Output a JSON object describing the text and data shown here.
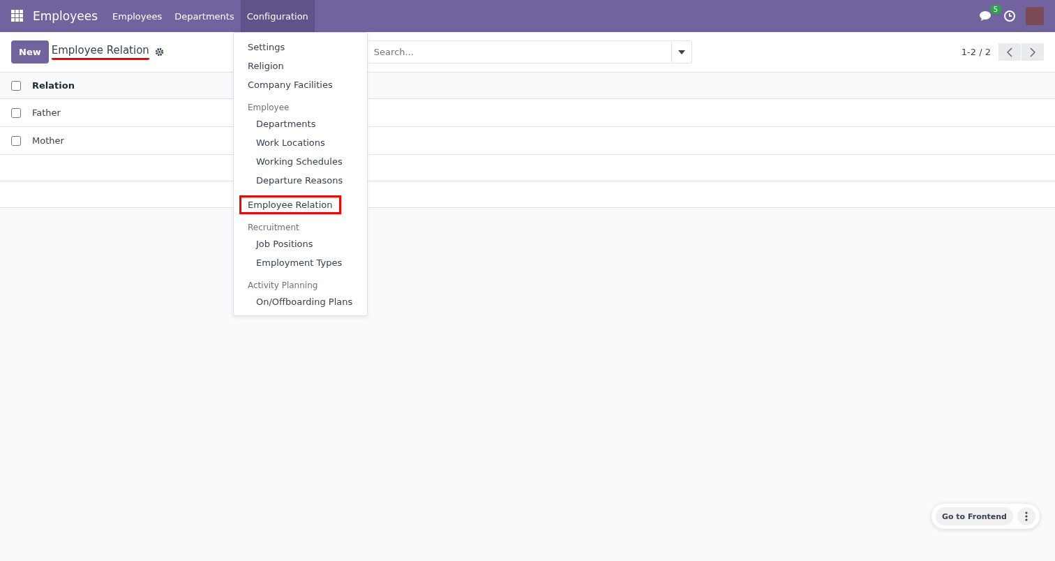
{
  "navbar": {
    "app_name": "Employees",
    "menus": [
      {
        "label": "Employees",
        "selected": false
      },
      {
        "label": "Departments",
        "selected": false
      },
      {
        "label": "Configuration",
        "selected": true
      }
    ],
    "messages_badge": "5"
  },
  "control_panel": {
    "new_button": "New",
    "title": "Employee Relation",
    "title_underlined": true,
    "search": {
      "placeholder": "Search..."
    },
    "pager": "1-2 / 2"
  },
  "table": {
    "columns": [
      "Relation"
    ],
    "all_checked": false,
    "rows": [
      {
        "cells": [
          "Father"
        ],
        "checked": false
      },
      {
        "cells": [
          "Mother"
        ],
        "checked": false
      }
    ]
  },
  "dropdown": [
    {
      "kind": "item",
      "label": "Settings",
      "highlighted": false
    },
    {
      "kind": "item",
      "label": "Religion",
      "highlighted": false
    },
    {
      "kind": "item",
      "label": "Company Facilities",
      "highlighted": false
    },
    {
      "kind": "header",
      "label": "Employee",
      "highlighted": false
    },
    {
      "kind": "subitem",
      "label": "Departments",
      "highlighted": false
    },
    {
      "kind": "subitem",
      "label": "Work Locations",
      "highlighted": false
    },
    {
      "kind": "subitem",
      "label": "Working Schedules",
      "highlighted": false
    },
    {
      "kind": "subitem",
      "label": "Departure Reasons",
      "highlighted": false
    },
    {
      "kind": "item",
      "label": "Employee Relation",
      "highlighted": true
    },
    {
      "kind": "header",
      "label": "Recruitment",
      "highlighted": false
    },
    {
      "kind": "subitem",
      "label": "Job Positions",
      "highlighted": false
    },
    {
      "kind": "subitem",
      "label": "Employment Types",
      "highlighted": false
    },
    {
      "kind": "header",
      "label": "Activity Planning",
      "highlighted": false
    },
    {
      "kind": "subitem",
      "label": "On/Offboarding Plans",
      "highlighted": false
    }
  ],
  "floating": {
    "button": "Go to Frontend"
  }
}
